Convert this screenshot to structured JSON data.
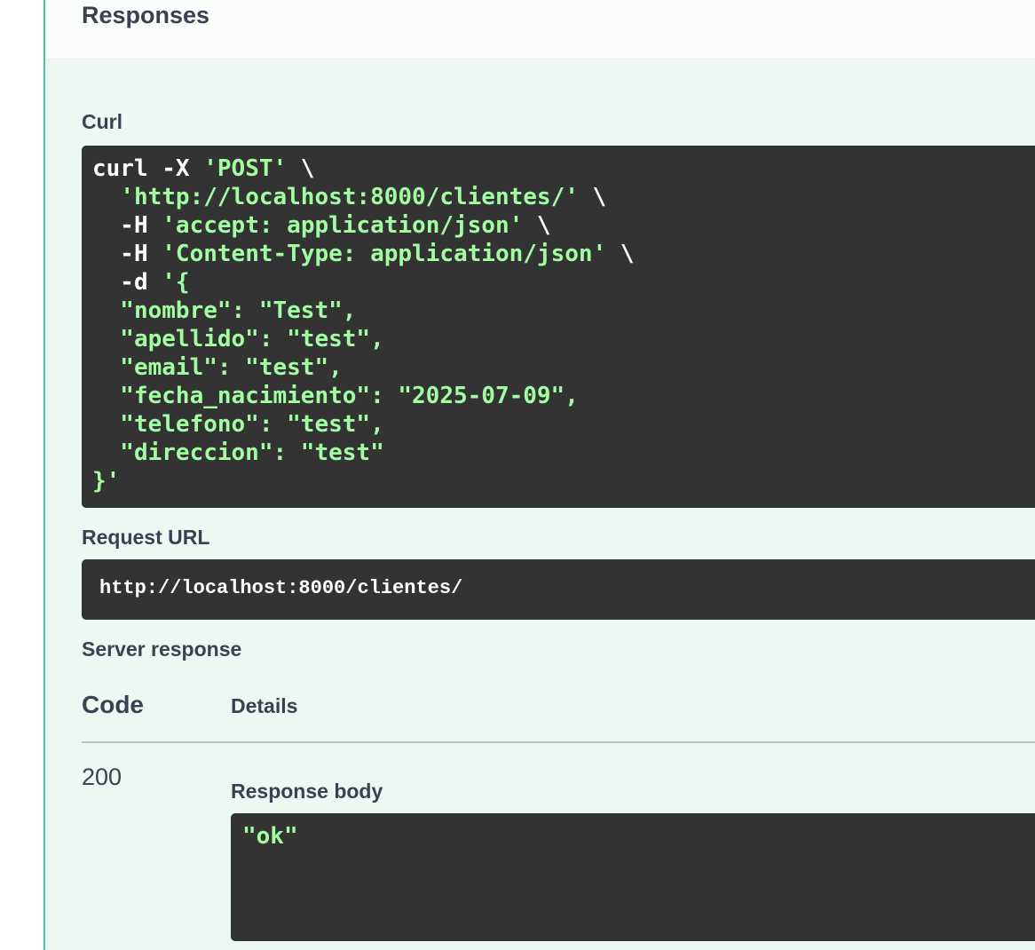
{
  "header": {
    "title": "Responses"
  },
  "curl": {
    "label": "Curl",
    "lines": [
      [
        {
          "t": "curl -X ",
          "c": "plain"
        },
        {
          "t": "'POST'",
          "c": "str"
        },
        {
          "t": " \\",
          "c": "plain"
        }
      ],
      [
        {
          "t": "  ",
          "c": "plain"
        },
        {
          "t": "'http://localhost:8000/clientes/'",
          "c": "str"
        },
        {
          "t": " \\",
          "c": "plain"
        }
      ],
      [
        {
          "t": "  -H ",
          "c": "plain"
        },
        {
          "t": "'accept: application/json'",
          "c": "str"
        },
        {
          "t": " \\",
          "c": "plain"
        }
      ],
      [
        {
          "t": "  -H ",
          "c": "plain"
        },
        {
          "t": "'Content-Type: application/json'",
          "c": "str"
        },
        {
          "t": " \\",
          "c": "plain"
        }
      ],
      [
        {
          "t": "  -d ",
          "c": "plain"
        },
        {
          "t": "'{",
          "c": "str"
        }
      ],
      [
        {
          "t": "  \"nombre\": \"Test\",",
          "c": "str"
        }
      ],
      [
        {
          "t": "  \"apellido\": \"test\",",
          "c": "str"
        }
      ],
      [
        {
          "t": "  \"email\": \"test\",",
          "c": "str"
        }
      ],
      [
        {
          "t": "  \"fecha_nacimiento\": \"2025-07-09\",",
          "c": "str"
        }
      ],
      [
        {
          "t": "  \"telefono\": \"test\",",
          "c": "str"
        }
      ],
      [
        {
          "t": "  \"direccion\": \"test\"",
          "c": "str"
        }
      ],
      [
        {
          "t": "}'",
          "c": "str"
        }
      ]
    ]
  },
  "request_url": {
    "label": "Request URL",
    "value": "http://localhost:8000/clientes/"
  },
  "server_response": {
    "label": "Server response",
    "columns": {
      "code": "Code",
      "details": "Details"
    },
    "rows": [
      {
        "code": "200",
        "response_body_label": "Response body",
        "response_body": "\"ok\""
      }
    ]
  },
  "colors": {
    "accent": "#49cc90",
    "code_bg": "#333333",
    "code_string": "#a2fca2",
    "section_bg": "#edf8f3",
    "text": "#3b4151"
  }
}
